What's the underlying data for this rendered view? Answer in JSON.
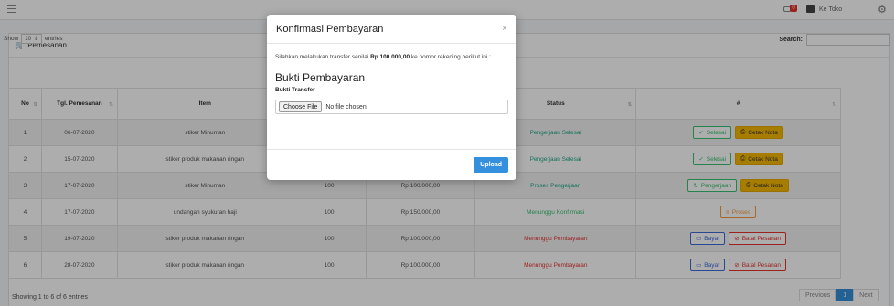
{
  "topbar": {
    "notification_count": "0",
    "store_link": "Ke Toko"
  },
  "card": {
    "title": "Pemesanan"
  },
  "controls": {
    "show_label": "Show",
    "entries_value": "10",
    "entries_label": "entries",
    "search_label": "Search:"
  },
  "table": {
    "headers": [
      "No",
      "Tgl. Pemesanan",
      "Item",
      "",
      "",
      "Status",
      "#"
    ],
    "rows": [
      {
        "no": "1",
        "date": "06-07-2020",
        "item": "stiker Minuman",
        "qty": "",
        "price": "",
        "status": "Pengerjaan Selesai",
        "status_class": "st-teal",
        "actions": [
          {
            "icon": "check-icon",
            "label": "Selesai",
            "style": "btn-ok"
          },
          {
            "icon": "print-icon",
            "label": "Cetak Nota",
            "style": "btn-yel"
          }
        ]
      },
      {
        "no": "2",
        "date": "15-07-2020",
        "item": "stiker produk makanan ringan",
        "qty": "",
        "price": "",
        "status": "Pengerjaan Selesai",
        "status_class": "st-teal",
        "actions": [
          {
            "icon": "check-icon",
            "label": "Selesai",
            "style": "btn-ok"
          },
          {
            "icon": "print-icon",
            "label": "Cetak Nota",
            "style": "btn-yel"
          }
        ]
      },
      {
        "no": "3",
        "date": "17-07-2020",
        "item": "stiker Minuman",
        "qty": "100",
        "price": "Rp 100.000,00",
        "status": "Proses Pengerjaan",
        "status_class": "st-teal",
        "actions": [
          {
            "icon": "refresh-icon",
            "label": "Pengerjaan",
            "style": "btn-ok"
          },
          {
            "icon": "print-icon",
            "label": "Cetak Nota",
            "style": "btn-yel"
          }
        ]
      },
      {
        "no": "4",
        "date": "17-07-2020",
        "item": "undangan syukuran haji",
        "qty": "100",
        "price": "Rp 150.000,00",
        "status": "Menunggu Konfirmasi",
        "status_class": "st-green",
        "actions": [
          {
            "icon": "money-icon",
            "label": "Proses",
            "style": "btn-orange"
          }
        ]
      },
      {
        "no": "5",
        "date": "19-07-2020",
        "item": "stiker produk makanan ringan",
        "qty": "100",
        "price": "Rp 100.000,00",
        "status": "Menunggu Pembayaran",
        "status_class": "st-red",
        "actions": [
          {
            "icon": "card-icon",
            "label": "Bayar",
            "style": "btn-blue"
          },
          {
            "icon": "ban-icon",
            "label": "Batal Pesanan",
            "style": "btn-red"
          }
        ]
      },
      {
        "no": "6",
        "date": "28-07-2020",
        "item": "stiker produk makanan ringan",
        "qty": "100",
        "price": "Rp 100.000,00",
        "status": "Menunggu Pembayaran",
        "status_class": "st-red",
        "actions": [
          {
            "icon": "card-icon",
            "label": "Bayar",
            "style": "btn-blue"
          },
          {
            "icon": "ban-icon",
            "label": "Batal Pesanan",
            "style": "btn-red"
          }
        ]
      }
    ]
  },
  "footer": {
    "info": "Showing 1 to 6 of 6 entries",
    "previous": "Previous",
    "page": "1",
    "next": "Next"
  },
  "modal": {
    "title": "Konfirmasi Pembayaran",
    "close": "×",
    "text_before": "Silahkan melakukan transfer senilai",
    "amount": "Rp 100.000,00",
    "text_after": "ke nomor rekening berikut ini :",
    "subtitle": "Bukti Pembayaran",
    "field_label": "Bukti Transfer",
    "choose_file": "Choose File",
    "no_file": "No file chosen",
    "upload": "Upload"
  }
}
